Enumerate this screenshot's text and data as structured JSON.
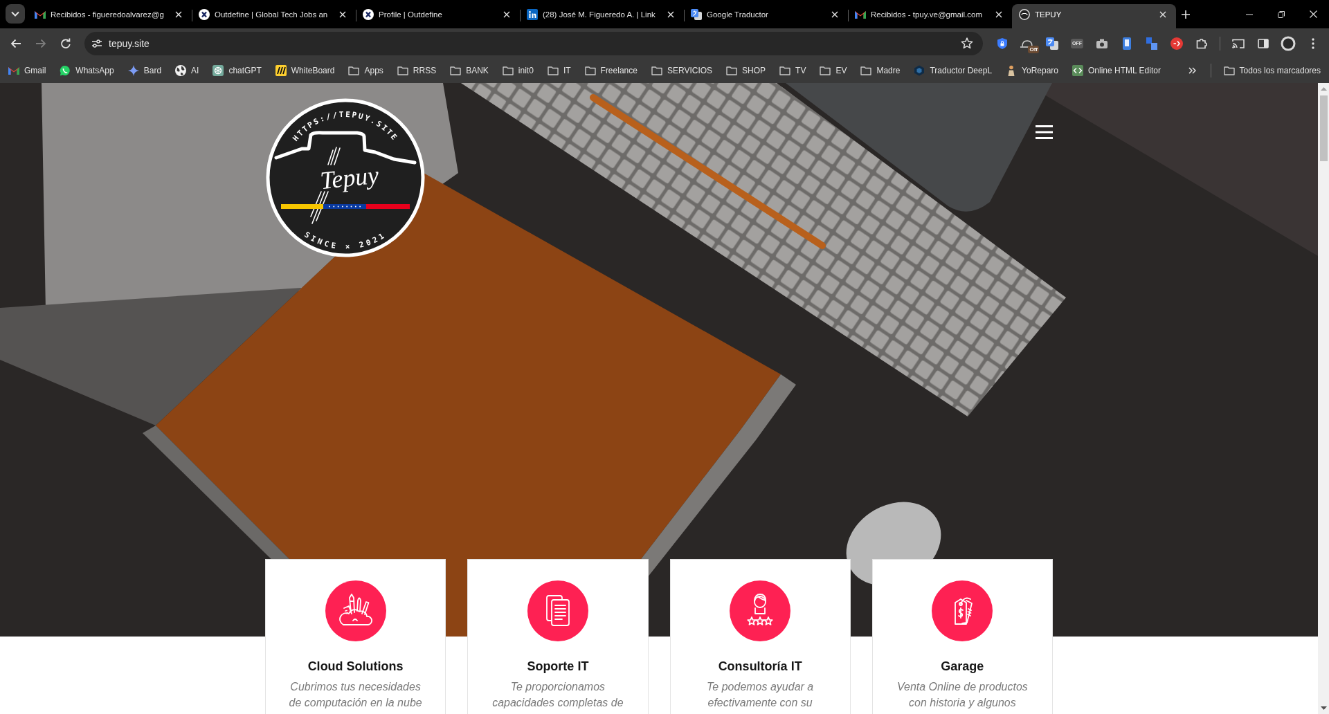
{
  "tab_strip": {
    "tabs": [
      {
        "title": "Recibidos - figueredoalvarez@g",
        "selected": false
      },
      {
        "title": "Outdefine | Global Tech Jobs an",
        "selected": false
      },
      {
        "title": "Profile | Outdefine",
        "selected": false
      },
      {
        "title": "(28) José M. Figueredo A. | Link",
        "selected": false
      },
      {
        "title": "Google Traductor",
        "selected": false
      },
      {
        "title": "Recibidos - tpuy.ve@gmail.com",
        "selected": false
      },
      {
        "title": "TEPUY",
        "selected": true
      }
    ]
  },
  "toolbar": {
    "back_disabled": false,
    "forward_disabled": true,
    "url": "tepuy.site",
    "extension_badge": "Off",
    "extension_tile_label": "OFF"
  },
  "bookmarks_bar": {
    "items": [
      {
        "label": "Gmail",
        "kind": "site"
      },
      {
        "label": "WhatsApp",
        "kind": "site"
      },
      {
        "label": "Bard",
        "kind": "site"
      },
      {
        "label": "AI",
        "kind": "site"
      },
      {
        "label": "chatGPT",
        "kind": "site"
      },
      {
        "label": "WhiteBoard",
        "kind": "site"
      },
      {
        "label": "Apps",
        "kind": "folder"
      },
      {
        "label": "RRSS",
        "kind": "folder"
      },
      {
        "label": "BANK",
        "kind": "folder"
      },
      {
        "label": "init0",
        "kind": "folder"
      },
      {
        "label": "IT",
        "kind": "folder"
      },
      {
        "label": "Freelance",
        "kind": "folder"
      },
      {
        "label": "SERVICIOS",
        "kind": "folder"
      },
      {
        "label": "SHOP",
        "kind": "folder"
      },
      {
        "label": "TV",
        "kind": "folder"
      },
      {
        "label": "EV",
        "kind": "folder"
      },
      {
        "label": "Madre",
        "kind": "folder"
      },
      {
        "label": "Traductor DeepL",
        "kind": "site"
      },
      {
        "label": "YoReparo",
        "kind": "site"
      },
      {
        "label": "Online HTML Editor",
        "kind": "site"
      }
    ],
    "all_bookmarks_label": "Todos los marcadores"
  },
  "page": {
    "logo": {
      "url_text": "HTTPS://TEPUY.SITE",
      "wordmark": "Tepuy",
      "since_text": "SINCE × 2021"
    },
    "services": [
      {
        "title": "Cloud Solutions",
        "description": "Cubrimos tus necesidades\nde computación en la nube"
      },
      {
        "title": "Soporte IT",
        "description": "Te proporcionamos\ncapacidades completas de"
      },
      {
        "title": "Consultoría IT",
        "description": "Te podemos ayudar a\nefectivamente con su"
      },
      {
        "title": "Garage",
        "description": "Venta Online de productos\ncon historia y algunos"
      }
    ]
  }
}
